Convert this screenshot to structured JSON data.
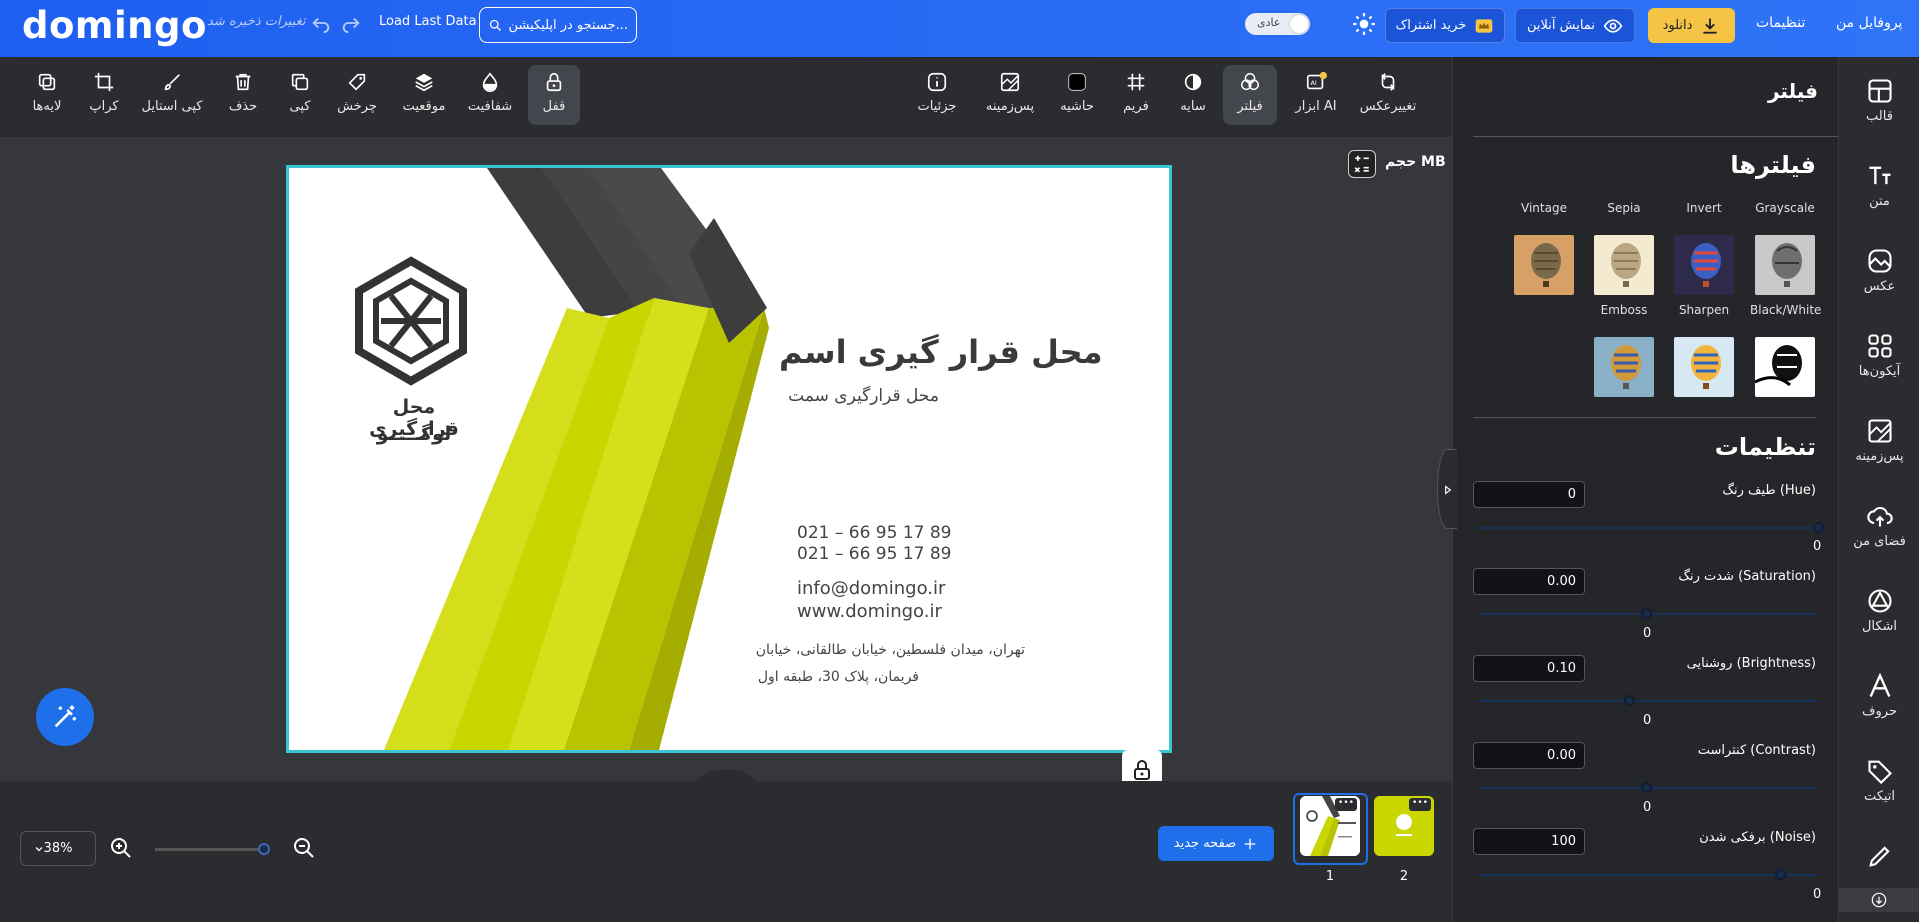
{
  "header": {
    "logo": "domingo",
    "unsaved": "تغییرات ذخیره شد",
    "load_last": "Load Last Data",
    "search_placeholder": "جستجو در اپلیکیشن...",
    "mode_label": "عادی",
    "subscribe": "خرید اشتراک",
    "preview": "نمایش آنلاین",
    "download": "دانلود",
    "settings": "تنظیمات",
    "profile": "پروفایل من"
  },
  "toolbar": {
    "change_photo": "تغییرعکس",
    "ai_tools": "ابزار AI",
    "filter": "فیلتر",
    "shadow": "سایه",
    "frame": "فریم",
    "border": "حاشیه",
    "background": "پس‌زمینه",
    "details": "جزئیات",
    "lock": "قفل",
    "opacity": "شفافیت",
    "position": "موقعیت",
    "rotate": "چرخش",
    "copy": "کپی",
    "delete": "حذف",
    "copy_style": "کپی استایل",
    "crop": "کراپ",
    "layers": "لایه‌ها"
  },
  "canvas": {
    "size_label": "حجم MB",
    "card": {
      "name": "محل قرار گیری اسم",
      "position": "محل قرارگیری سمت",
      "phone1": "021 – 66 95 17 89",
      "phone2": "021 – 66 95 17 89",
      "email": "info@domingo.ir",
      "website": "www.domingo.ir",
      "address1": "تهران، میدان فلسطین، خیابان طالقانی، خیابان",
      "address2": "فریمان، پلاک 30، طبقه اول",
      "logo_line1": "محل قرارگیری",
      "logo_line2": "لوگـــــو"
    }
  },
  "bottom": {
    "zoom": "38%",
    "new_page": "صفحه جدید",
    "pages": [
      "1",
      "2"
    ]
  },
  "panel": {
    "title": "فیلتر",
    "filters_heading": "فیلترها",
    "filters": [
      "Grayscale",
      "Invert",
      "Sepia",
      "Vintage",
      "Black/White",
      "Sharpen",
      "Emboss"
    ],
    "settings_heading": "تنظیمات",
    "adjustments": [
      {
        "label": "طیف رنگ (Hue)",
        "value": "0",
        "readout": "0",
        "pos": 1.0
      },
      {
        "label": "شدت رنگ (Saturation)",
        "value": "0.00",
        "readout": "0",
        "pos": 0.5
      },
      {
        "label": "روشنایی (Brightness)",
        "value": "0.10",
        "readout": "0",
        "pos": 0.45
      },
      {
        "label": "کنتراست (Contrast)",
        "value": "0.00",
        "readout": "0",
        "pos": 0.5
      },
      {
        "label": "برفکی شدن (Noise)",
        "value": "100",
        "readout": "0",
        "pos": 0.9
      }
    ]
  },
  "sidebar": {
    "items": [
      "قالب",
      "متن",
      "عکس",
      "آیکون‌ها",
      "پس‌زمینه",
      "فضای من",
      "اشکال",
      "حروف",
      "اتیکت"
    ]
  },
  "colors": {
    "header_blue": "#2a6cf5",
    "accent_yellow": "#f6c445",
    "frame_cyan": "#39c7d6",
    "lime": "#c9d600"
  }
}
